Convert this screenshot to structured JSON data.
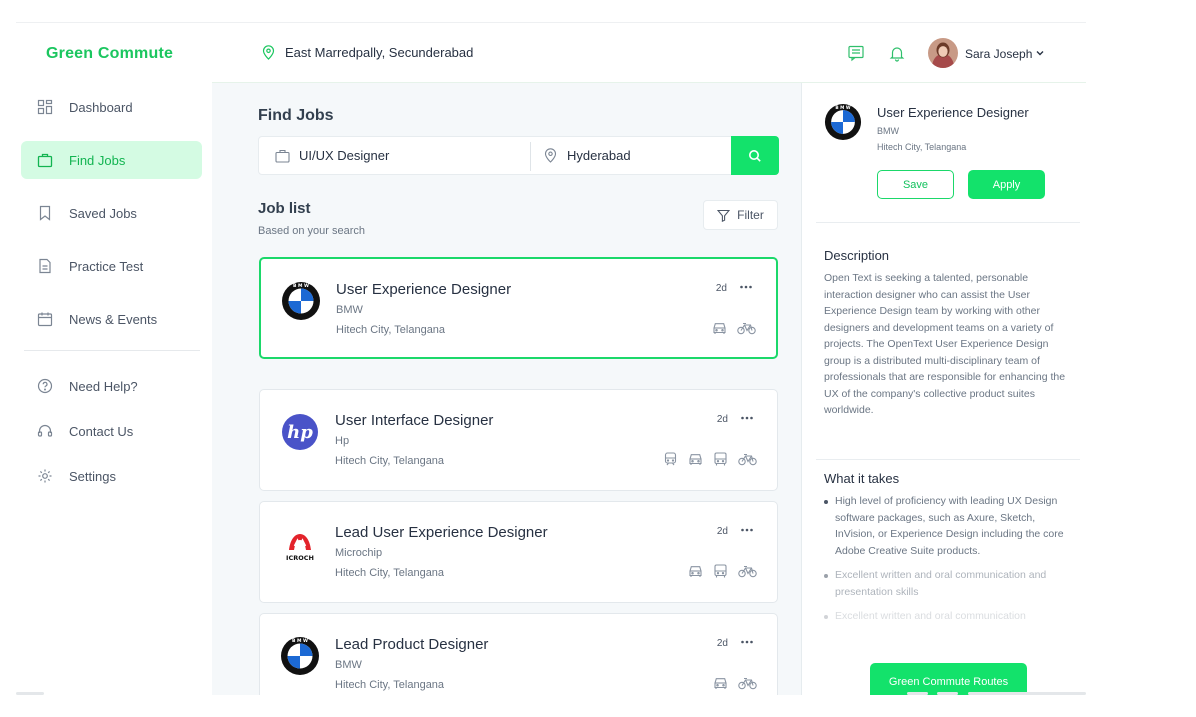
{
  "brand": "Green Commute",
  "sidebar": {
    "items": [
      {
        "label": "Dashboard",
        "icon": "dashboard-icon"
      },
      {
        "label": "Find Jobs",
        "icon": "briefcase-icon",
        "active": true
      },
      {
        "label": "Saved Jobs",
        "icon": "bookmark-icon"
      },
      {
        "label": "Practice Test",
        "icon": "document-icon"
      },
      {
        "label": "News & Events",
        "icon": "calendar-icon"
      }
    ],
    "secondary": [
      {
        "label": "Need Help?",
        "icon": "help-icon"
      },
      {
        "label": "Contact Us",
        "icon": "headset-icon"
      },
      {
        "label": "Settings",
        "icon": "gear-icon"
      }
    ]
  },
  "header": {
    "location": "East Marredpally, Secunderabad",
    "user_name": "Sara Joseph",
    "icons": [
      "message-icon",
      "bell-icon",
      "chevron-down-icon"
    ]
  },
  "main": {
    "title": "Find Jobs",
    "search": {
      "role_value": "UI/UX Designer",
      "location_value": "Hyderabad"
    },
    "list_title": "Job list",
    "list_subtitle": "Based on your search",
    "filter_label": "Filter",
    "jobs": [
      {
        "title": "User Experience Designer",
        "company": "BMW",
        "location": "Hitech City, Telangana",
        "posted": "2d",
        "logo": "bmw-logo",
        "modes": [
          "car-icon",
          "bike-icon"
        ]
      },
      {
        "title": "User Interface Designer",
        "company": "Hp",
        "location": "Hitech City, Telangana",
        "posted": "2d",
        "logo": "hp-logo",
        "modes": [
          "train-icon",
          "car-icon",
          "bus-icon",
          "bike-icon"
        ]
      },
      {
        "title": "Lead User Experience Designer",
        "company": "Microchip",
        "location": "Hitech City, Telangana",
        "posted": "2d",
        "logo": "microchip-logo",
        "logo_text": "ICROCH",
        "modes": [
          "car-icon",
          "bus-icon",
          "bike-icon"
        ]
      },
      {
        "title": "Lead Product Designer",
        "company": "BMW",
        "location": "Hitech City, Telangana",
        "posted": "2d",
        "logo": "bmw-logo",
        "modes": [
          "car-icon",
          "bike-icon"
        ]
      }
    ]
  },
  "detail": {
    "title": "User Experience Designer",
    "company": "BMW",
    "location": "Hitech City, Telangana",
    "save_label": "Save",
    "apply_label": "Apply",
    "description_heading": "Description",
    "description": "Open Text is seeking a talented, personable interaction designer who can assist the User Experience Design team by working with other designers and development teams on a variety of projects. The OpenText User Experience Design group is a distributed multi-disciplinary team of professionals that are responsible for enhancing the UX of the company's collective product suites worldwide.",
    "requirements_heading": "What it takes",
    "requirements": [
      "High level of proficiency with leading UX Design software packages, such as Axure, Sketch, InVision, or Experience Design including the core Adobe Creative Suite products.",
      "Excellent written and oral communication and presentation skills",
      "Excellent written and oral communication"
    ],
    "routes_label": "Green Commute Routes"
  },
  "colors": {
    "accent": "#13e26b",
    "brand_text": "#1bc65f",
    "active_nav_bg": "#d4fbe3"
  }
}
